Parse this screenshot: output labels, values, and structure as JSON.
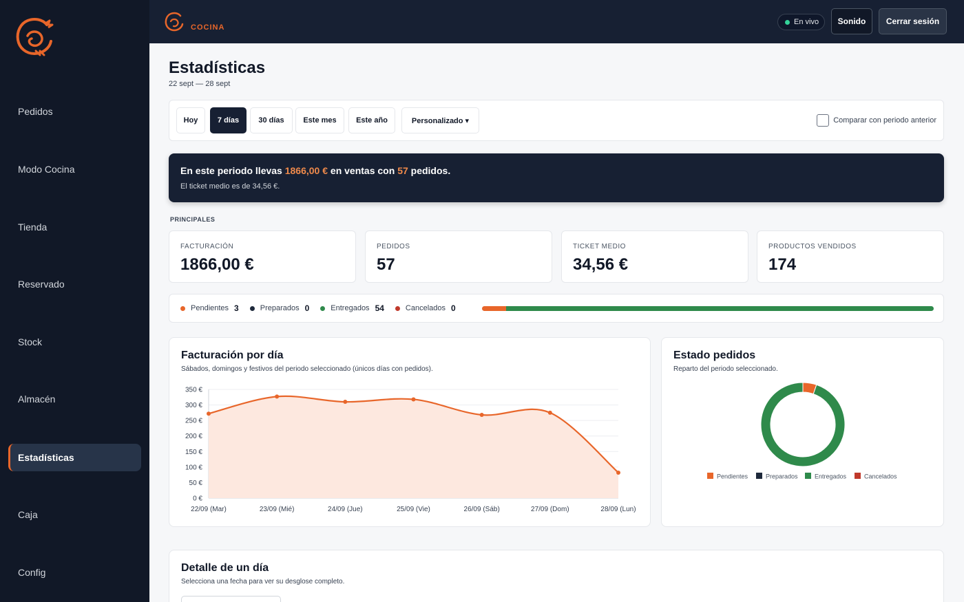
{
  "sidebar": {
    "items": [
      {
        "label": "Pedidos"
      },
      {
        "label": "Modo Cocina"
      },
      {
        "label": "Tienda"
      },
      {
        "label": "Reservado"
      },
      {
        "label": "Stock"
      },
      {
        "label": "Almacén"
      },
      {
        "label": "Estadísticas",
        "active": true
      },
      {
        "label": "Caja"
      },
      {
        "label": "Config"
      }
    ]
  },
  "header": {
    "brand": "COCINA",
    "live": "En vivo",
    "sound": "Sonido",
    "logout": "Cerrar sesión"
  },
  "page": {
    "title": "Estadísticas",
    "range": "22 sept — 28 sept"
  },
  "filters": {
    "buttons": [
      "Hoy",
      "7 días",
      "30 días",
      "Este mes",
      "Este año",
      "Personalizado ▾"
    ],
    "active_index": 1,
    "compare_label": "Comparar con periodo anterior"
  },
  "banner": {
    "prefix": "En este periodo llevas ",
    "amount": "1866,00 €",
    "middle": " en ventas con ",
    "orders": "57",
    "suffix": " pedidos.",
    "ticket_text": "El ticket medio es de 34,56 €."
  },
  "principales": {
    "section_label": "PRINCIPALES",
    "kpis": [
      {
        "label": "FACTURACIÓN",
        "value": "1866,00 €"
      },
      {
        "label": "PEDIDOS",
        "value": "57"
      },
      {
        "label": "TICKET MEDIO",
        "value": "34,56 €"
      },
      {
        "label": "PRODUCTOS VENDIDOS",
        "value": "174"
      }
    ]
  },
  "status": {
    "items": [
      {
        "label": "Pendientes",
        "count": "3",
        "color": "#e8662a"
      },
      {
        "label": "Preparados",
        "count": "0",
        "color": "#1e293b"
      },
      {
        "label": "Entregados",
        "count": "54",
        "color": "#2f8a4b"
      },
      {
        "label": "Cancelados",
        "count": "0",
        "color": "#c0392b"
      }
    ]
  },
  "revenue_chart": {
    "title": "Facturación por día",
    "subtitle": "Sábados, domingos y festivos del periodo seleccionado (únicos días con pedidos)."
  },
  "donut_chart": {
    "title": "Estado pedidos",
    "subtitle": "Reparto del periodo seleccionado."
  },
  "detail": {
    "title": "Detalle de un día",
    "subtitle": "Selecciona una fecha para ver su desglose completo."
  },
  "chart_data": [
    {
      "type": "area",
      "categories": [
        "22/09 (Mar)",
        "23/09 (Mié)",
        "24/09 (Jue)",
        "25/09 (Vie)",
        "26/09 (Sáb)",
        "27/09 (Dom)",
        "28/09 (Lun)"
      ],
      "values": [
        272,
        327,
        310,
        318,
        268,
        275,
        82
      ],
      "ylim": [
        0,
        350
      ],
      "yticks": [
        "0 €",
        "50 €",
        "100 €",
        "150 €",
        "200 €",
        "250 €",
        "300 €",
        "350 €"
      ],
      "color": "#e8662a",
      "fill": "#fde8df",
      "grid": true
    },
    {
      "type": "pie",
      "donut": true,
      "labels": [
        "Pendientes",
        "Preparados",
        "Entregados",
        "Cancelados"
      ],
      "values": [
        3,
        0,
        54,
        0
      ],
      "colors": [
        "#e8662a",
        "#1e293b",
        "#2f8a4b",
        "#c0392b"
      ],
      "legend": "bottom"
    }
  ]
}
